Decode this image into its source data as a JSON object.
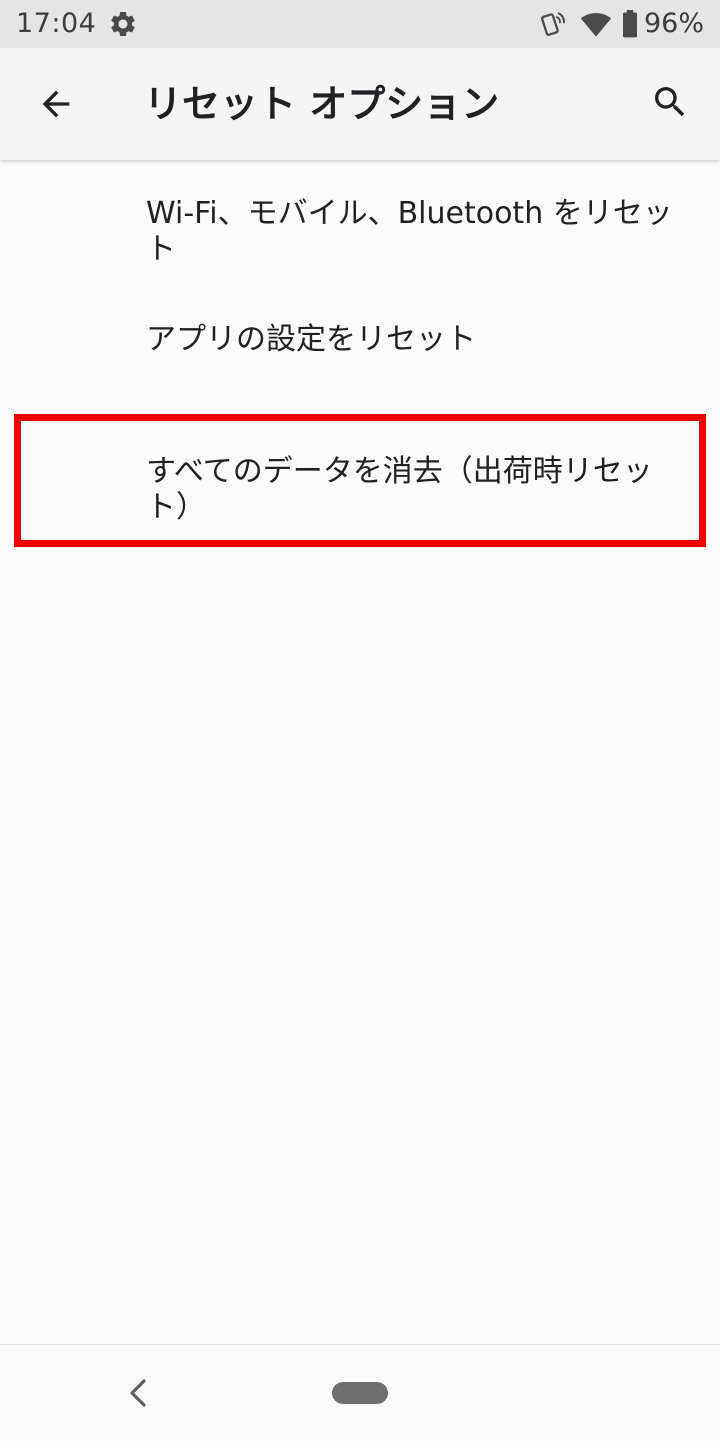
{
  "status_bar": {
    "time": "17:04",
    "battery_percent": "96%",
    "icons": [
      "settings-gear-icon",
      "nfc-icon",
      "wifi-icon",
      "battery-icon"
    ]
  },
  "app_bar": {
    "title": "リセット オプション",
    "back_icon": "arrow-back-icon",
    "search_icon": "search-icon"
  },
  "menu": {
    "items": [
      {
        "label": "Wi-Fi、モバイル、Bluetooth をリセット"
      },
      {
        "label": "アプリの設定をリセット"
      },
      {
        "label": "すべてのデータを消去（出荷時リセット）"
      }
    ]
  },
  "highlight": {
    "color": "#ee0000",
    "target_item": 2
  },
  "nav_bar": {
    "back_icon": "nav-back-icon",
    "home_icon": "home-pill-icon"
  },
  "colors": {
    "status_bar_bg": "#e5e5e5",
    "app_bar_bg": "#f5f5f5",
    "page_bg": "#fafafa",
    "text": "#202124"
  }
}
